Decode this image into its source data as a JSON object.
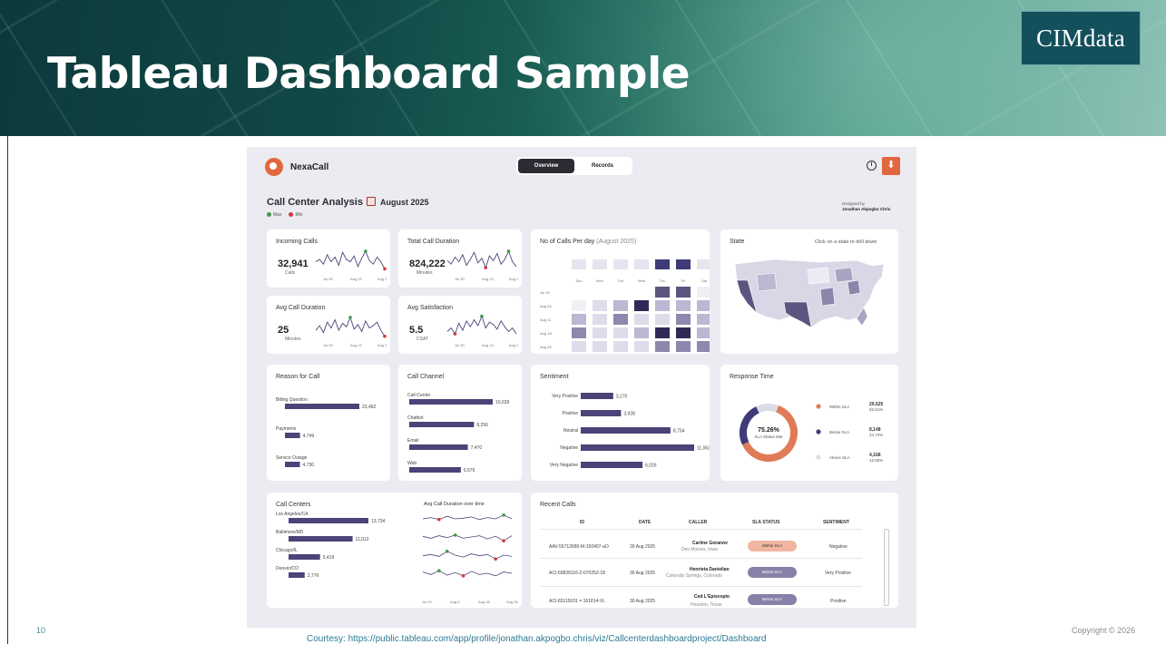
{
  "slide": {
    "title": "Tableau Dashboard Sample",
    "logo": "CIMdata",
    "page_number": "10",
    "courtesy": "Courtesy: https://public.tableau.com/app/profile/jonathan.akpogbo.chris/viz/Callcenterdashboardproject/Dashboard",
    "copyright": "Copyright © 2026"
  },
  "dashboard": {
    "brand": "NexaCall",
    "tabs": [
      {
        "label": "Overview",
        "active": true
      },
      {
        "label": "Records",
        "active": false
      }
    ],
    "heading": "Call Center Analysis",
    "month": "August 2025",
    "legend": {
      "max": "Max",
      "min": "Min",
      "max_color": "#3e9a4a",
      "min_color": "#d23a3a"
    },
    "designed_by_label": "Designed by",
    "designed_by_name": "Jonathan Akpogbo Chris",
    "kpis": [
      {
        "title": "Incoming Calls",
        "value": "32,941",
        "unit": "Calls",
        "ticks": [
          "Jul 30",
          "Aug 13",
          "Aug 27"
        ]
      },
      {
        "title": "Total Call Duration",
        "value": "824,222",
        "unit": "Minutes",
        "ticks": [
          "Jul 30",
          "Aug 13",
          "Aug 27"
        ]
      },
      {
        "title": "Avg Call Duration",
        "value": "25",
        "unit": "Minutes",
        "ticks": [
          "Jul 30",
          "Aug 13",
          "Aug 27"
        ]
      },
      {
        "title": "Avg Satisfaction",
        "value": "5.5",
        "unit": "CSAT",
        "ticks": [
          "Jul 30",
          "Aug 14",
          "Aug 29"
        ]
      }
    ],
    "calls_per_day": {
      "title": "No of Calls Per day",
      "subtitle": "(August 2025)",
      "days": [
        "Sun",
        "Mon",
        "Tue",
        "Wed",
        "Thu",
        "Fri",
        "Sat"
      ],
      "weeks": [
        "Jul 28",
        "Aug 04",
        "Aug 11",
        "Aug 18",
        "Aug 25"
      ]
    },
    "state": {
      "title": "State",
      "hint": "Click on a state to drill down"
    },
    "reason_for_call": {
      "title": "Reason for Call",
      "items": [
        {
          "label": "Billing Question",
          "value": 23462,
          "text": "23,462"
        },
        {
          "label": "Payments",
          "value": 4749,
          "text": "4,749"
        },
        {
          "label": "Service Outage",
          "value": 4730,
          "text": "4,730"
        }
      ]
    },
    "call_channel": {
      "title": "Call Channel",
      "items": [
        {
          "label": "Call-Center",
          "value": 10639,
          "text": "10,639"
        },
        {
          "label": "Chatbot",
          "value": 8256,
          "text": "8,256"
        },
        {
          "label": "Email",
          "value": 7470,
          "text": "7,470"
        },
        {
          "label": "Web",
          "value": 6576,
          "text": "6,576"
        }
      ]
    },
    "sentiment": {
      "title": "Sentiment",
      "items": [
        {
          "label": "Very Positive",
          "value": 3170,
          "text": "3,170"
        },
        {
          "label": "Positive",
          "value": 3928,
          "text": "3,928"
        },
        {
          "label": "Neutral",
          "value": 8754,
          "text": "8,754"
        },
        {
          "label": "Negative",
          "value": 11063,
          "text": "11,063"
        },
        {
          "label": "Very Negative",
          "value": 6026,
          "text": "6,026"
        }
      ]
    },
    "response_time": {
      "title": "Response Time",
      "center_value": "75.26%",
      "center_label": "SLA Status Met",
      "items": [
        {
          "label": "Within SLA",
          "count": "20,625",
          "pct": "62.61%",
          "value": 62.61,
          "color": "#e07a57"
        },
        {
          "label": "Below SLA",
          "count": "8,148",
          "pct": "24.74%",
          "value": 24.74,
          "color": "#3f3a78"
        },
        {
          "label": "Above SLA",
          "count": "4,168",
          "pct": "12.65%",
          "value": 12.65,
          "color": "#dcdce6"
        }
      ]
    },
    "call_centers": {
      "title": "Call Centers",
      "trend_title": "Avg Call Duration over time",
      "items": [
        {
          "label": "Los Angeles/CA",
          "value": 13734,
          "text": "13,734"
        },
        {
          "label": "Baltimore/MD",
          "value": 11012,
          "text": "11,012"
        },
        {
          "label": "Chicago/IL",
          "value": 5419,
          "text": "5,419"
        },
        {
          "label": "Denver/CO",
          "value": 2776,
          "text": "2,776"
        }
      ],
      "ticks": [
        "Jul 29",
        "Aug 8",
        "Aug 18",
        "Aug 28"
      ]
    },
    "recent_calls": {
      "title": "Recent Calls",
      "columns": [
        "ID",
        "DATE",
        "CALLER",
        "SLA STATUS",
        "SENTIMENT"
      ],
      "rows": [
        {
          "id": "AAV-55712680-M-150407-aO",
          "date": "30 Aug 2025",
          "caller": "Carline Goranov",
          "city": "Des Moines, Iowa",
          "sla": "Within SLA",
          "sentiment": "Negative"
        },
        {
          "id": "ACI-69828116-2-070252-18",
          "date": "30 Aug 2025",
          "caller": "Henrieta Danielian",
          "city": "Colorado Springs, Colorado",
          "sla": "Below SLA",
          "sentiment": "Very Positive"
        },
        {
          "id": "ACI-83115031 = 161814-VL",
          "date": "30 Aug 2025",
          "caller": "Ced L'Episcopio",
          "city": "Houston, Texas",
          "sla": "Below SLA",
          "sentiment": "Positive"
        }
      ]
    }
  }
}
